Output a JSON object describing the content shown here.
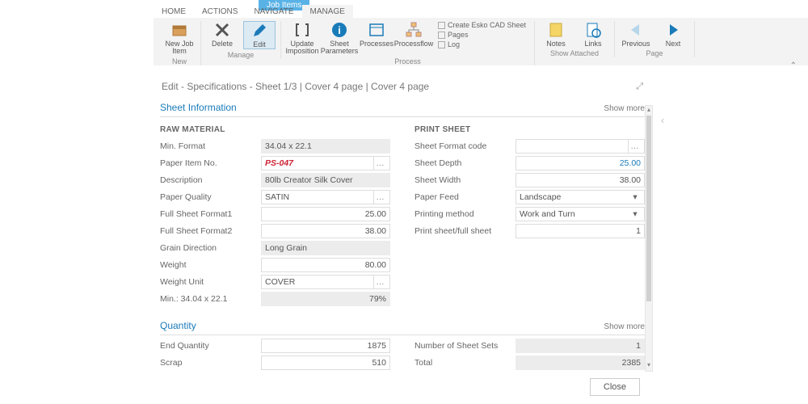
{
  "topTabs": {
    "highlight": "Job Items",
    "items": [
      "HOME",
      "ACTIONS",
      "NAVIGATE",
      "MANAGE"
    ],
    "activeIndex": 3
  },
  "ribbon": {
    "groups": [
      {
        "label": "New",
        "buttons": [
          {
            "name": "new-job-item",
            "label": "New Job\nItem",
            "icon": "box"
          }
        ]
      },
      {
        "label": "Manage",
        "buttons": [
          {
            "name": "delete",
            "label": "Delete",
            "icon": "x"
          },
          {
            "name": "edit",
            "label": "Edit",
            "icon": "pencil",
            "active": true
          }
        ]
      },
      {
        "label": "Process",
        "buttons": [
          {
            "name": "update-imposition",
            "label": "Update\nImposition",
            "icon": "brackets"
          },
          {
            "name": "sheet-parameters",
            "label": "Sheet\nParameters",
            "icon": "info"
          },
          {
            "name": "processes",
            "label": "Processes",
            "icon": "window"
          },
          {
            "name": "processflow",
            "label": "Processflow",
            "icon": "flow"
          }
        ],
        "checks": [
          {
            "label": "Create Esko CAD Sheet"
          },
          {
            "label": "Pages"
          },
          {
            "label": "Log"
          }
        ]
      },
      {
        "label": "Show Attached",
        "buttons": [
          {
            "name": "notes",
            "label": "Notes",
            "icon": "note"
          },
          {
            "name": "links",
            "label": "Links",
            "icon": "link"
          }
        ]
      },
      {
        "label": "Page",
        "buttons": [
          {
            "name": "previous",
            "label": "Previous",
            "icon": "prev"
          },
          {
            "name": "next",
            "label": "Next",
            "icon": "next"
          }
        ]
      }
    ]
  },
  "breadcrumb": "Edit - Specifications - Sheet 1/3 | Cover 4 page | Cover 4 page",
  "sections": {
    "sheetInfo": {
      "title": "Sheet Information",
      "showMore": "Show more",
      "rawLabel": "RAW MATERIAL",
      "printLabel": "PRINT SHEET",
      "raw": {
        "minFormat": {
          "label": "Min. Format",
          "value": "34.04 x 22.1"
        },
        "paperItem": {
          "label": "Paper Item No.",
          "value": "PS-047"
        },
        "description": {
          "label": "Description",
          "value": "80lb Creator Silk Cover"
        },
        "paperQuality": {
          "label": "Paper Quality",
          "value": "SATIN"
        },
        "fullSheet1": {
          "label": "Full Sheet Format1",
          "value": "25.00"
        },
        "fullSheet2": {
          "label": "Full Sheet Format2",
          "value": "38.00"
        },
        "grain": {
          "label": "Grain Direction",
          "value": "Long Grain"
        },
        "weight": {
          "label": "Weight",
          "value": "80.00"
        },
        "weightUnit": {
          "label": "Weight Unit",
          "value": "COVER"
        },
        "minPct": {
          "label": "Min.: 34.04 x 22.1",
          "value": "79%"
        }
      },
      "print": {
        "formatCode": {
          "label": "Sheet Format code",
          "value": ""
        },
        "depth": {
          "label": "Sheet Depth",
          "value": "25.00"
        },
        "width": {
          "label": "Sheet Width",
          "value": "38.00"
        },
        "feed": {
          "label": "Paper Feed",
          "value": "Landscape"
        },
        "method": {
          "label": "Printing method",
          "value": "Work and Turn"
        },
        "pfull": {
          "label": "Print sheet/full sheet",
          "value": "1"
        }
      }
    },
    "quantity": {
      "title": "Quantity",
      "showMore": "Show more",
      "left": {
        "endQty": {
          "label": "End Quantity",
          "value": "1875"
        },
        "scrap": {
          "label": "Scrap",
          "value": "510"
        }
      },
      "right": {
        "numSets": {
          "label": "Number of Sheet Sets",
          "value": "1"
        },
        "total": {
          "label": "Total",
          "value": "2385"
        }
      }
    }
  },
  "close": "Close"
}
